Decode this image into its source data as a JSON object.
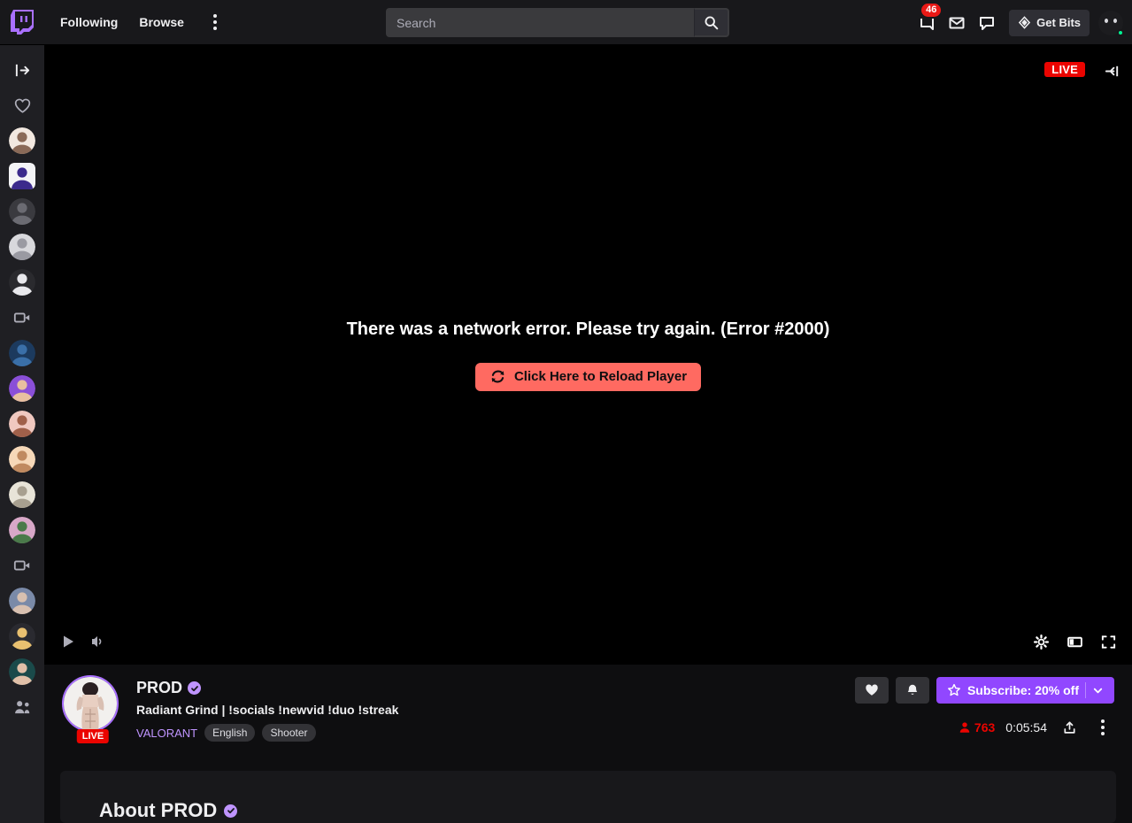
{
  "nav": {
    "logo_icon": "twitch-logo-icon",
    "following_label": "Following",
    "browse_label": "Browse",
    "more_icon": "more-vertical-icon",
    "search_placeholder": "Search",
    "search_value": "",
    "search_icon": "search-icon",
    "notifications_icon": "notifications-icon",
    "notifications_badge": "46",
    "inbox_icon": "inbox-icon",
    "whispers_icon": "whispers-icon",
    "bits_icon": "bits-diamond-icon",
    "bits_label": "Get Bits",
    "avatar_icon": "user-avatar",
    "presence_color": "#00f593"
  },
  "sidebar": {
    "expand_icon": "expand-sidebar-icon",
    "followed_icon": "heart-icon",
    "friends_icon": "friends-icon",
    "items": [
      {
        "name": "sidebar-channel-1",
        "type": "avatar",
        "colors": [
          "#f2e8e0",
          "#8a6a58"
        ]
      },
      {
        "name": "sidebar-channel-2",
        "type": "square",
        "colors": [
          "#f4f4f6",
          "#3b2a8c"
        ]
      },
      {
        "name": "sidebar-channel-3",
        "type": "avatar",
        "colors": [
          "#3a3a3f",
          "#6b6b72"
        ]
      },
      {
        "name": "sidebar-channel-4",
        "type": "avatar",
        "colors": [
          "#d8d8dc",
          "#9a9aa2"
        ]
      },
      {
        "name": "sidebar-channel-5",
        "type": "avatar",
        "colors": [
          "#2a2a2e",
          "#e8e8ec"
        ]
      },
      {
        "name": "sidebar-video-1",
        "type": "videoicon",
        "colors": [
          "#adadb8",
          "#adadb8"
        ]
      },
      {
        "name": "sidebar-channel-6",
        "type": "avatar",
        "colors": [
          "#1c3a5e",
          "#3a6fa8"
        ]
      },
      {
        "name": "sidebar-channel-7",
        "type": "avatar",
        "colors": [
          "#8a4fd8",
          "#e8c0a0"
        ]
      },
      {
        "name": "sidebar-channel-8",
        "type": "avatar",
        "colors": [
          "#f0c8c0",
          "#a0604a"
        ]
      },
      {
        "name": "sidebar-channel-9",
        "type": "avatar",
        "colors": [
          "#f6d8b8",
          "#c08a60"
        ]
      },
      {
        "name": "sidebar-channel-10",
        "type": "avatar",
        "colors": [
          "#e8e4d8",
          "#a8a090"
        ]
      },
      {
        "name": "sidebar-channel-11",
        "type": "avatar",
        "colors": [
          "#d8a8c8",
          "#4a7a4a"
        ]
      },
      {
        "name": "sidebar-video-2",
        "type": "videoicon",
        "colors": [
          "#adadb8",
          "#adadb8"
        ]
      },
      {
        "name": "sidebar-channel-12",
        "type": "avatar",
        "colors": [
          "#7a8aa8",
          "#d8c0b0"
        ]
      },
      {
        "name": "sidebar-channel-13",
        "type": "avatar",
        "colors": [
          "#2a2a30",
          "#e8c070"
        ]
      },
      {
        "name": "sidebar-channel-14",
        "type": "avatar",
        "colors": [
          "#1a4a4a",
          "#e0c0a8"
        ]
      }
    ]
  },
  "player": {
    "live_label": "LIVE",
    "collapse_icon": "collapse-chat-icon",
    "error_text": "There was a network error. Please try again. (Error #2000)",
    "reload_label": "Click Here to Reload Player",
    "reload_icon": "refresh-icon",
    "reload_color": "#ff6a61",
    "play_icon": "play-icon",
    "mute_icon": "volume-icon",
    "settings_icon": "gear-icon",
    "theater_icon": "theater-mode-icon",
    "fullscreen_icon": "fullscreen-icon"
  },
  "channel": {
    "avatar_icon": "channel-avatar",
    "live_label": "LIVE",
    "name": "PROD",
    "verified_icon": "verified-icon",
    "stream_title": "Radiant Grind | !socials !newvid !duo !streak",
    "category": "VALORANT",
    "tags": [
      "English",
      "Shooter"
    ],
    "follow_icon": "heart-icon",
    "notify_icon": "bell-icon",
    "subscribe_icon": "star-icon",
    "subscribe_label": "Subscribe: 20% off",
    "subscribe_chevron_icon": "chevron-down-icon",
    "subscribe_color": "#9147ff",
    "viewers_icon": "viewer-count-icon",
    "viewers": "763",
    "uptime": "0:05:54",
    "share_icon": "share-icon",
    "more_icon": "more-vertical-icon"
  },
  "about": {
    "title": "About PROD",
    "verified_icon": "verified-icon"
  }
}
